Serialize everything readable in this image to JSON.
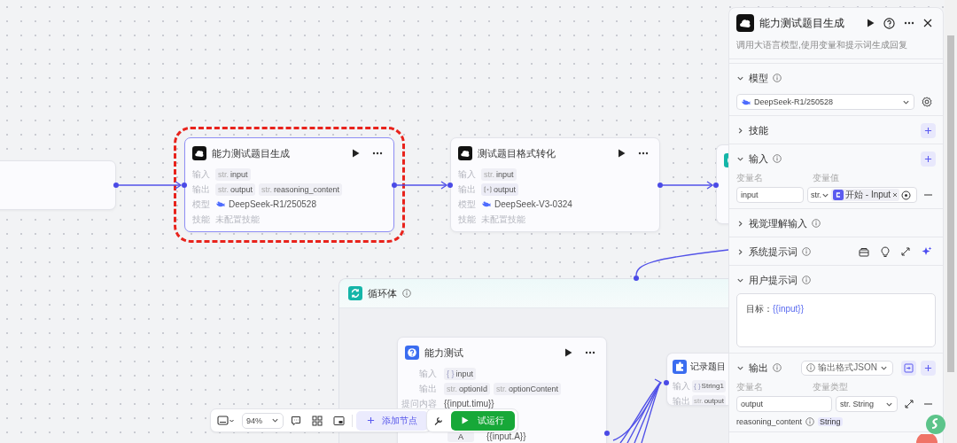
{
  "canvas": {
    "nodes": [
      {
        "selected": false
      },
      {
        "title": "能力测试题目生成",
        "selected": true,
        "rows": [
          {
            "kind": "vars",
            "label": "输入",
            "tags": [
              {
                "kind": "str",
                "type": "str.",
                "name": "input"
              }
            ]
          },
          {
            "kind": "vars",
            "label": "输出",
            "tags": [
              {
                "kind": "str",
                "type": "str.",
                "name": "output"
              },
              {
                "kind": "str",
                "type": "str.",
                "name": "reasoning_content"
              }
            ]
          },
          {
            "kind": "model",
            "label": "模型",
            "value": "DeepSeek-R1/250528"
          },
          {
            "kind": "text",
            "label": "技能",
            "value": "未配置技能"
          }
        ]
      },
      {
        "title": "测试题目格式转化",
        "selected": false,
        "rows": [
          {
            "kind": "vars",
            "label": "输入",
            "tags": [
              {
                "kind": "str",
                "type": "str.",
                "name": "input"
              }
            ]
          },
          {
            "kind": "vars",
            "label": "输出",
            "tags": [
              {
                "kind": "array",
                "name": "output"
              }
            ]
          },
          {
            "kind": "model",
            "label": "模型",
            "value": "DeepSeek-V3-0324"
          },
          {
            "kind": "text",
            "label": "技能",
            "value": "未配置技能"
          }
        ]
      },
      {
        "selected": false
      }
    ],
    "loop": {
      "title": "循环体",
      "nodes": [
        {
          "title": "能力测试",
          "selected": false,
          "rows": [
            {
              "kind": "vars",
              "label": "输入",
              "tags": [
                {
                  "kind": "object",
                  "type": "{ }",
                  "name": "input"
                }
              ]
            },
            {
              "kind": "vars",
              "label": "输出",
              "tags": [
                {
                  "kind": "str",
                  "type": "str.",
                  "name": "optionId"
                },
                {
                  "kind": "str",
                  "type": "str.",
                  "name": "optionContent"
                }
              ]
            },
            {
              "kind": "ref",
              "label": "提问内容",
              "value": "{{input.timu}}"
            },
            {
              "kind": "option",
              "key": "A",
              "value": "{{input.A}}"
            }
          ]
        },
        {
          "title": "记录题目",
          "selected": false,
          "rows": [
            {
              "kind": "vars",
              "label": "输入",
              "tags": [
                {
                  "kind": "object",
                  "type": "{ }",
                  "name": "String1"
                }
              ]
            },
            {
              "kind": "vars",
              "label": "输出",
              "tags": [
                {
                  "kind": "str",
                  "type": "str.",
                  "name": "output"
                }
              ]
            }
          ]
        }
      ]
    }
  },
  "toolbar": {
    "zoom": "94%",
    "add_node": "添加节点",
    "run": "试运行"
  },
  "panel": {
    "title": "能力测试题目生成",
    "description": "调用大语言模型,使用变量和提示词生成回复",
    "sections": [
      {
        "kind": "model",
        "title": "模型",
        "info": true,
        "expanded": true,
        "model": "DeepSeek-R1/250528"
      },
      {
        "kind": "plain",
        "title": "技能",
        "expanded": false,
        "add": true
      },
      {
        "kind": "inputs",
        "title": "输入",
        "info": true,
        "expanded": true,
        "add": true,
        "columns": [
          "变量名",
          "变量值"
        ],
        "rows": [
          {
            "name": "input",
            "type": "str.",
            "source": "开始 - Input"
          }
        ]
      },
      {
        "kind": "plain",
        "title": "视觉理解输入",
        "info": true,
        "expanded": false
      },
      {
        "kind": "system",
        "title": "系统提示词",
        "info": true,
        "expanded": false
      },
      {
        "kind": "prompt",
        "title": "用户提示词",
        "info": true,
        "expanded": true,
        "label": "目标：",
        "variable": "{{input}}"
      },
      {
        "kind": "outputs",
        "title": "输出",
        "info": true,
        "expanded": true,
        "add": true,
        "format": "输出格式JSON",
        "columns": [
          "变量名",
          "变量类型"
        ],
        "rows": [
          {
            "kind": "field",
            "name": "output",
            "type": "str. String"
          },
          {
            "kind": "static",
            "name": "reasoning_content",
            "type": "String"
          }
        ]
      }
    ]
  }
}
